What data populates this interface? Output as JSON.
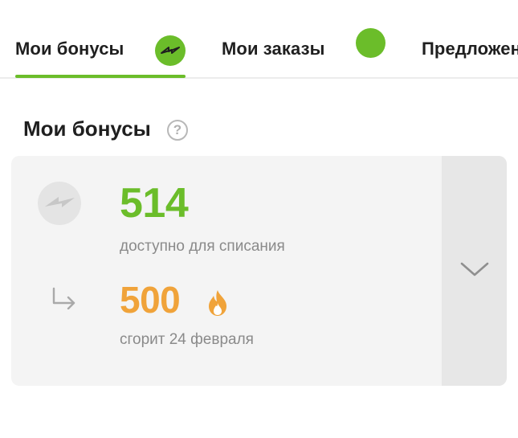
{
  "tabs": [
    {
      "label": "Мои бонусы",
      "active": true,
      "badge_icon": "bolt-icon"
    },
    {
      "label": "Мои заказы",
      "active": false,
      "badge_icon": "status-dot"
    },
    {
      "label": "Предложения",
      "active": false
    }
  ],
  "section": {
    "title": "Мои бонусы",
    "help_icon": "?"
  },
  "bonus_card": {
    "available": {
      "amount": "514",
      "caption": "доступно для списания",
      "icon": "bolt-icon"
    },
    "expiring": {
      "amount": "500",
      "caption": "сгорит 24 февраля",
      "icon": "fire-icon",
      "prefix_icon": "arrow-down-right-icon"
    },
    "toggle_icon": "chevron-down-icon"
  },
  "colors": {
    "accent_green": "#6bbd2a",
    "accent_orange": "#f0a33a",
    "card_bg": "#f4f4f4",
    "toggle_bg": "#e7e7e7",
    "muted_text": "#8a8a8a"
  }
}
